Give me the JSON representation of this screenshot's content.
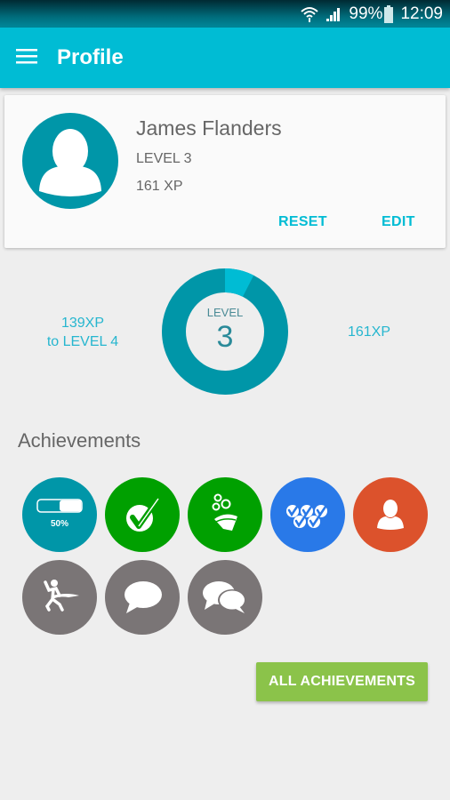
{
  "status_bar": {
    "icons": [
      "wifi-icon",
      "signal-icon",
      "battery-icon"
    ],
    "battery": "99%",
    "time": "12:09"
  },
  "app_bar": {
    "menu_icon": "hamburger-menu-icon",
    "title": "Profile"
  },
  "profile": {
    "avatar_icon": "user-avatar-icon",
    "name": "James Flanders",
    "level": "LEVEL 3",
    "xp": "161 XP",
    "reset_label": "RESET",
    "edit_label": "EDIT"
  },
  "level_progress": {
    "xp_to_next_line1": "139XP",
    "xp_to_next_line2": "to LEVEL 4",
    "current_xp": "161XP",
    "ring_label": "LEVEL",
    "ring_value": "3",
    "progress_fraction": 0.075,
    "colors": {
      "ring": "#0096a8",
      "progress": "#00bcd4"
    }
  },
  "achievements": {
    "title": "Achievements",
    "badges": [
      {
        "name": "progress-50-badge",
        "icon": "progress-bar-icon",
        "label": "50%",
        "color": "#0096a8",
        "progress": 0.5
      },
      {
        "name": "checkmark-badge",
        "icon": "checkmark-circle-icon",
        "color": "#00a000"
      },
      {
        "name": "magic-hat-badge",
        "icon": "magic-hat-icon",
        "color": "#00a000"
      },
      {
        "name": "multi-check-badge",
        "icon": "multi-checkmark-icon",
        "color": "#2979e8"
      },
      {
        "name": "profile-badge",
        "icon": "person-icon",
        "color": "#dc522c"
      },
      {
        "name": "finish-line-badge",
        "icon": "finish-line-runner-icon",
        "color": "#7a7576"
      },
      {
        "name": "comment-badge",
        "icon": "speech-bubble-icon",
        "color": "#7a7576"
      },
      {
        "name": "conversation-badge",
        "icon": "speech-bubbles-icon",
        "color": "#7a7576"
      }
    ],
    "all_button_label": "ALL ACHIEVEMENTS"
  }
}
